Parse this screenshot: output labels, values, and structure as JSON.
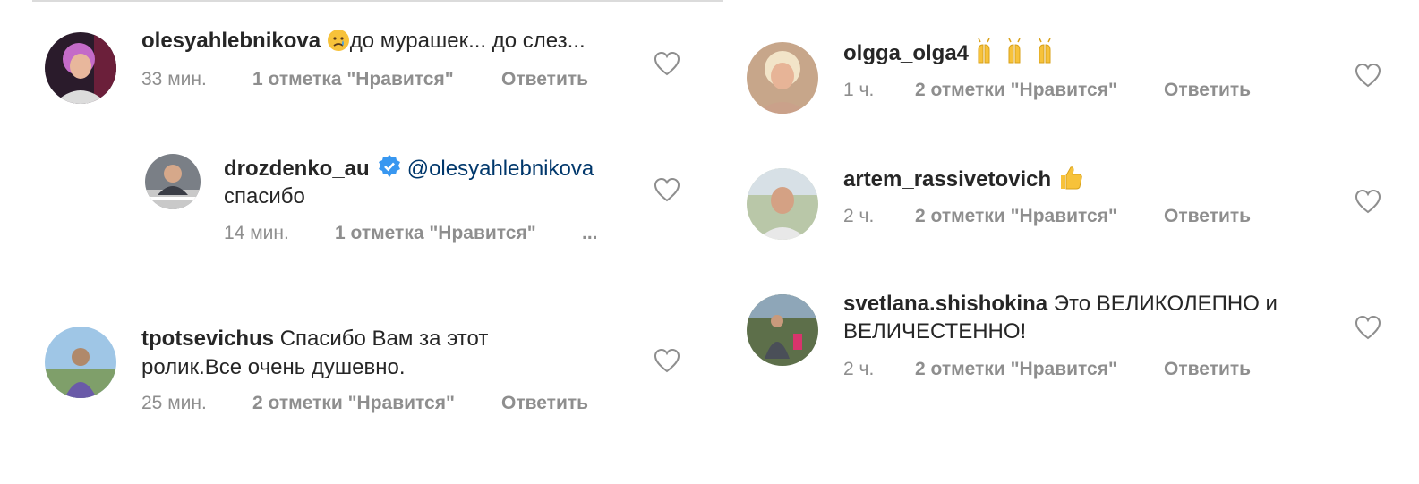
{
  "left_column": {
    "c1": {
      "username": "olesyahlebnikova",
      "emoji": "crying-face-emoji",
      "text": "до мурашек... до слез...",
      "time": "33 мин.",
      "likes": "1 отметка \"Нравится\"",
      "reply": "Ответить"
    },
    "c1_reply": {
      "username": "drozdenko_au",
      "mention": "@olesyahlebnikova",
      "text": "спасибо",
      "time": "14 мин.",
      "likes": "1 отметка \"Нравится\"",
      "more": "..."
    },
    "c2": {
      "username": "tpotsevichus",
      "text_line1": "Спасибо Вам за этот",
      "text_line2": "ролик.Все очень душевно.",
      "time": "25 мин.",
      "likes": "2 отметки \"Нравится\"",
      "reply": "Ответить"
    }
  },
  "right_column": {
    "c3": {
      "username": "olgga_olga4",
      "emoji": "raising-hands-emoji",
      "time": "1 ч.",
      "likes": "2 отметки \"Нравится\"",
      "reply": "Ответить"
    },
    "c4": {
      "username": "artem_rassivetovich",
      "emoji": "thumbs-up-emoji",
      "time": "2 ч.",
      "likes": "2 отметки \"Нравится\"",
      "reply": "Ответить"
    },
    "c5": {
      "username": "svetlana.shishokina",
      "text_line1": "Это ВЕЛИКОЛЕПНО и",
      "text_line2": "ВЕЛИЧЕСТЕННО!",
      "time": "2 ч.",
      "likes": "2 отметки \"Нравится\"",
      "reply": "Ответить"
    }
  },
  "colors": {
    "text": "#262626",
    "meta": "#8e8e8e",
    "mention": "#00376b",
    "verified": "#3897f0"
  }
}
